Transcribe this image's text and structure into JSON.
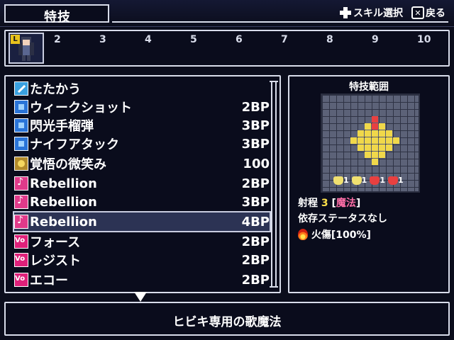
{
  "header": {
    "title": "特技",
    "hints": [
      {
        "icon": "dpad-icon",
        "label": "スキル選択"
      },
      {
        "icon": "x-button-icon",
        "label": "戻る"
      }
    ]
  },
  "turn_order": {
    "current_badge": "L",
    "slots": [
      "2",
      "3",
      "4",
      "5",
      "6",
      "7",
      "8",
      "9",
      "10"
    ]
  },
  "skills": [
    {
      "icon": "attack-icon",
      "name": "たたかう",
      "cost": ""
    },
    {
      "icon": "skill-icon",
      "name": "ウィークショット",
      "cost": "2BP"
    },
    {
      "icon": "skill-icon",
      "name": "閃光手榴弾",
      "cost": "3BP"
    },
    {
      "icon": "skill-icon",
      "name": "ナイフアタック",
      "cost": "3BP"
    },
    {
      "icon": "gold-icon",
      "name": "覚悟の微笑み",
      "cost": "100"
    },
    {
      "icon": "song-icon",
      "name": "Rebellion",
      "cost": "2BP"
    },
    {
      "icon": "song-icon",
      "name": "Rebellion",
      "cost": "3BP"
    },
    {
      "icon": "song-icon",
      "name": "Rebellion",
      "cost": "4BP",
      "selected": true
    },
    {
      "icon": "vocal-icon",
      "name": "フォース",
      "cost": "2BP"
    },
    {
      "icon": "vocal-icon",
      "name": "レジスト",
      "cost": "2BP"
    },
    {
      "icon": "vocal-icon",
      "name": "エコー",
      "cost": "2BP"
    }
  ],
  "range_panel": {
    "title": "特技範囲",
    "stat_changes": [
      "1",
      "1",
      "1",
      "1"
    ],
    "range_label": "射程",
    "range_value": "3",
    "range_type": "魔法",
    "dependency": "依存ステータスなし",
    "effect": "火傷[100%]"
  },
  "description": "ヒビキ専用の歌魔法",
  "colors": {
    "selection": "#6e7dbe",
    "range_center": "#e84040",
    "range_area": "#f0d84a",
    "highlight_yellow": "#ffe14a",
    "highlight_pink": "#ff6fa8"
  }
}
